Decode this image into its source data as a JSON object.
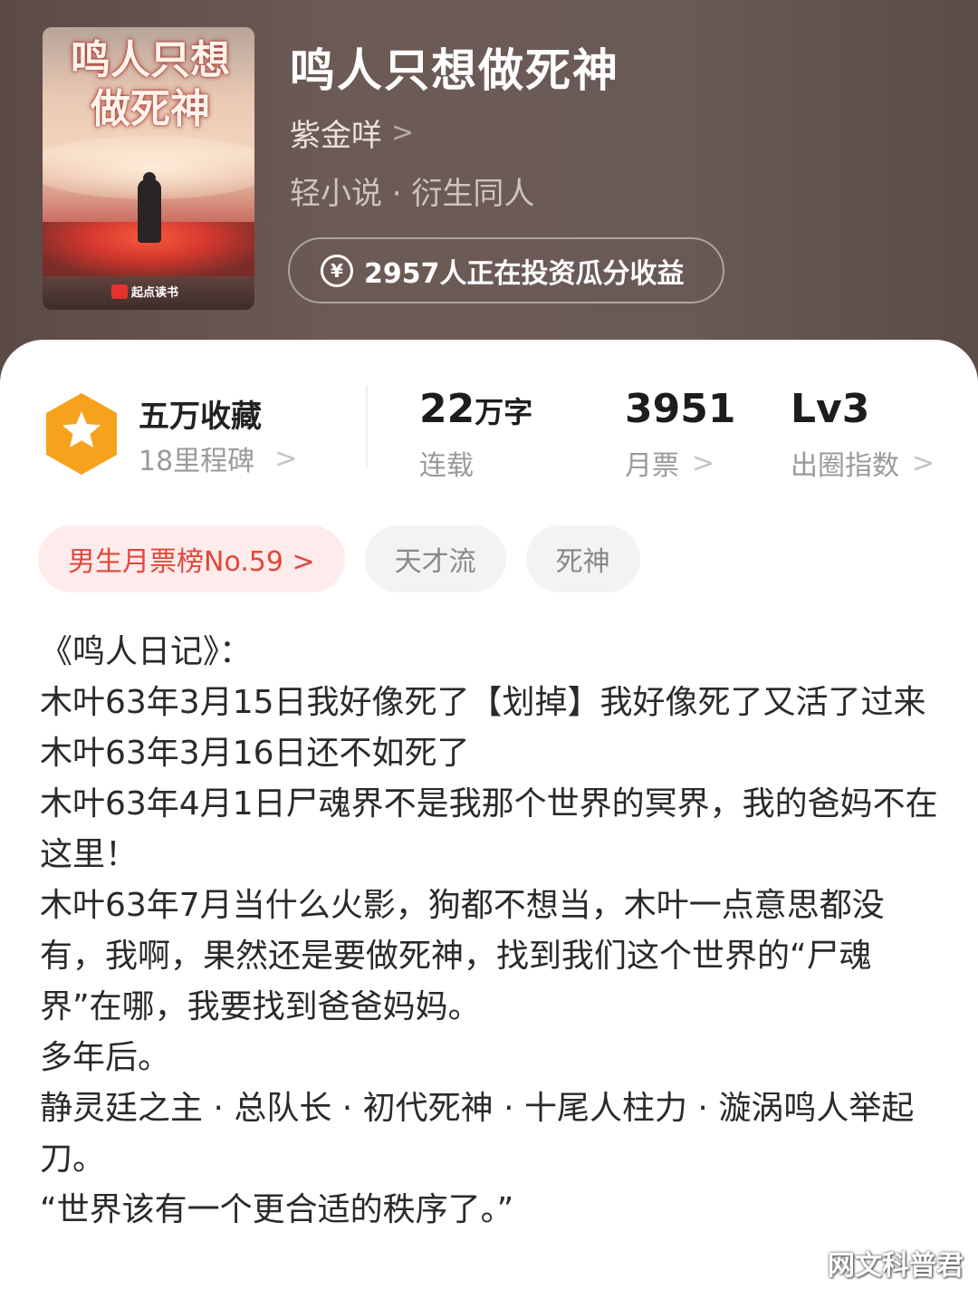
{
  "book": {
    "cover_title": "鸣人只想做死神",
    "cover_publisher": "起点读书",
    "title": "鸣人只想做死神",
    "author": "紫金咩",
    "author_chevron": ">",
    "genre": "轻小说 · 衍生同人",
    "invest_icon": "¥",
    "invest_text": "2957人正在投资瓜分收益"
  },
  "stats": {
    "collect_title": "五万收藏",
    "collect_sub": "18里程碑",
    "words_value": "22",
    "words_unit": "万字",
    "words_label": "连载",
    "votes_value": "3951",
    "votes_label": "月票",
    "level_value": "Lv3",
    "level_label": "出圈指数",
    "chevron": ">"
  },
  "tags": [
    {
      "label": "男生月票榜No.59 >"
    },
    {
      "label": "天才流"
    },
    {
      "label": "死神"
    }
  ],
  "description": [
    "《鸣人日记》：",
    "木叶63年3月15日我好像死了【划掉】我好像死了又活了过来",
    "木叶63年3月16日还不如死了",
    "木叶63年4月1日尸魂界不是我那个世界的冥界，我的爸妈不在这里！",
    "木叶63年7月当什么火影，狗都不想当，木叶一点意思都没有，我啊，果然还是要做死神，找到我们这个世界的“尸魂界”在哪，我要找到爸爸妈妈。",
    "多年后。",
    "静灵廷之主 · 总队长 · 初代死神 · 十尾人柱力 · 漩涡鸣人举起刀。",
    "“世界该有一个更合适的秩序了。”"
  ],
  "watermark": "网文科普君",
  "colors": {
    "header_bg": "#6a5a56",
    "badge_orange": "#f7a21c",
    "rank_tag_bg": "#fdeceb",
    "rank_tag_text": "#e2463c"
  },
  "icons": [
    "yen-icon",
    "star-badge-icon",
    "chevron-right-icon"
  ]
}
